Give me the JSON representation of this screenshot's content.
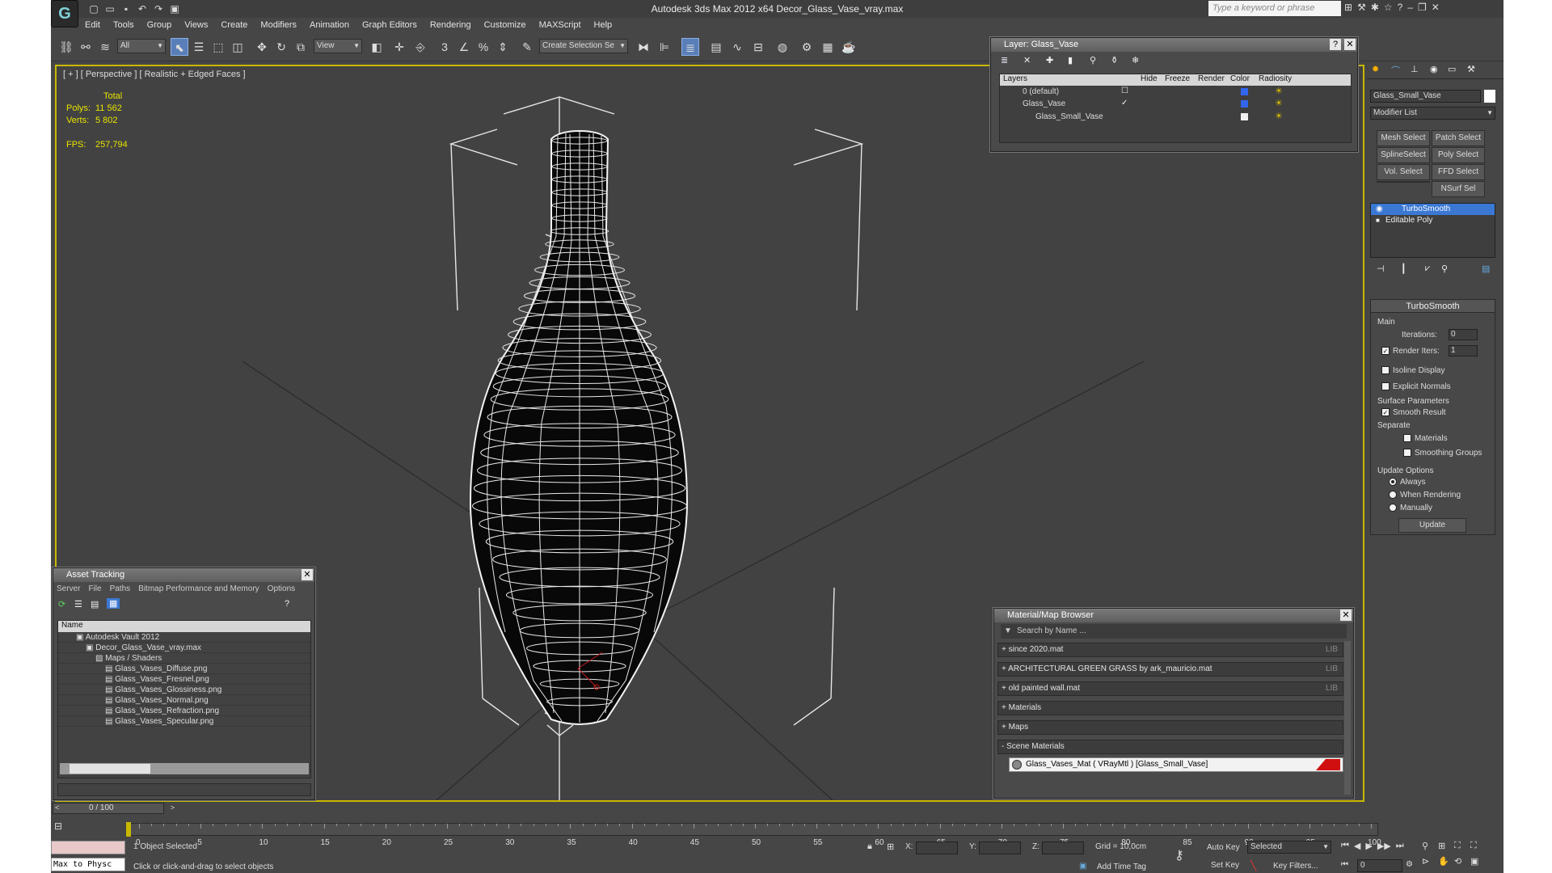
{
  "app": {
    "title": "Autodesk 3ds Max  2012 x64      Decor_Glass_Vase_vray.max",
    "logo": "G",
    "search_placeholder": "Type a keyword or phrase"
  },
  "menu": [
    "Edit",
    "Tools",
    "Group",
    "Views",
    "Create",
    "Modifiers",
    "Animation",
    "Graph Editors",
    "Rendering",
    "Customize",
    "MAXScript",
    "Help"
  ],
  "toolbar": {
    "filter_value": "All",
    "refcoord_value": "View",
    "selection_set_placeholder": "Create Selection Se"
  },
  "viewport": {
    "label": "[ + ] [ Perspective ] [ Realistic + Edged Faces ]",
    "stats_header": "Total",
    "polys_label": "Polys:",
    "polys_value": "11 562",
    "verts_label": "Verts:",
    "verts_value": "5 802",
    "fps_label": "FPS:",
    "fps_value": "257,794"
  },
  "layer_panel": {
    "title": "Layer: Glass_Vase",
    "columns": [
      "Layers",
      "Hide",
      "Freeze",
      "Render",
      "Color",
      "Radiosity"
    ],
    "rows": [
      {
        "name": "0 (default)"
      },
      {
        "name": "Glass_Vase"
      },
      {
        "name": "Glass_Small_Vase"
      }
    ]
  },
  "asset_panel": {
    "title": "Asset Tracking",
    "menu": [
      "Server",
      "File",
      "Paths",
      "Bitmap Performance and Memory",
      "Options"
    ],
    "column": "Name",
    "items": [
      "Autodesk Vault 2012",
      "Decor_Glass_Vase_vray.max",
      "Maps / Shaders",
      "Glass_Vases_Diffuse.png",
      "Glass_Vases_Fresnel.png",
      "Glass_Vases_Glossiness.png",
      "Glass_Vases_Normal.png",
      "Glass_Vases_Refraction.png",
      "Glass_Vases_Specular.png"
    ]
  },
  "material_browser": {
    "title": "Material/Map Browser",
    "search_placeholder": "Search by Name ...",
    "groups": [
      {
        "label": "+ since 2020.mat",
        "tag": "LIB"
      },
      {
        "label": "+ ARCHITECTURAL GREEN GRASS by ark_mauricio.mat",
        "tag": "LIB"
      },
      {
        "label": "+ old painted wall.mat",
        "tag": "LIB"
      },
      {
        "label": "+ Materials",
        "tag": ""
      },
      {
        "label": "+ Maps",
        "tag": ""
      },
      {
        "label": "- Scene Materials",
        "tag": ""
      }
    ],
    "scene_material": "Glass_Vases_Mat  ( VRayMtl )  [Glass_Small_Vase]"
  },
  "command_panel": {
    "object_name": "Glass_Small_Vase",
    "modifier_list": "Modifier List",
    "buttons": [
      "Mesh Select",
      "Patch Select",
      "SplineSelect",
      "Poly Select",
      "Vol. Select",
      "FFD Select",
      "",
      "NSurf Sel"
    ],
    "stack": [
      "TurboSmooth",
      "Editable Poly"
    ],
    "rollout_title": "TurboSmooth",
    "main_label": "Main",
    "iterations_label": "Iterations:",
    "iterations_value": "0",
    "render_iters_label": "Render Iters:",
    "render_iters_value": "1",
    "isoline": "Isoline Display",
    "explicit": "Explicit Normals",
    "surface_params": "Surface Parameters",
    "smooth_result": "Smooth Result",
    "separate": "Separate",
    "materials": "Materials",
    "smoothing_groups": "Smoothing Groups",
    "update_options": "Update Options",
    "always": "Always",
    "when_rendering": "When Rendering",
    "manually": "Manually",
    "update_btn": "Update"
  },
  "timeline": {
    "frame": "0 / 100",
    "ticks": [
      "0",
      "5",
      "10",
      "15",
      "20",
      "25",
      "30",
      "35",
      "40",
      "45",
      "50",
      "55",
      "60",
      "65",
      "70",
      "75",
      "80",
      "85",
      "90",
      "95",
      "100"
    ]
  },
  "status": {
    "maxscript": "Max to Physc",
    "selected": "1 Object Selected",
    "prompt": "Click or click-and-drag to select objects",
    "x_label": "X:",
    "y_label": "Y:",
    "z_label": "Z:",
    "grid": "Grid = 10,0cm",
    "add_time_tag": "Add Time Tag",
    "auto_key": "Auto Key",
    "set_key": "Set Key",
    "selected_dd": "Selected",
    "key_filters": "Key Filters...",
    "frame_field": "0"
  },
  "colors": {
    "viewport_border": "#c8b800",
    "stats": "#e8e400",
    "selection": "#3a78d4",
    "mat_swatch": "#d01010"
  }
}
